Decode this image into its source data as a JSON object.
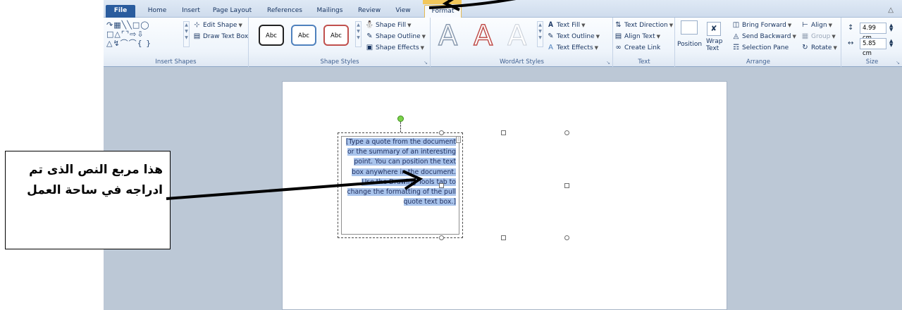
{
  "tabs": [
    "File",
    "Home",
    "Insert",
    "Page Layout",
    "References",
    "Mailings",
    "Review",
    "View",
    "Format"
  ],
  "active_tab": "Format",
  "ribbon": {
    "insert_shapes": {
      "label": "Insert Shapes",
      "edit_shape": "Edit Shape",
      "draw_text_box": "Draw Text Box"
    },
    "shape_styles": {
      "label": "Shape Styles",
      "thumbnails": [
        "Abc",
        "Abc",
        "Abc"
      ],
      "shape_fill": "Shape Fill",
      "shape_outline": "Shape Outline",
      "shape_effects": "Shape Effects"
    },
    "wordart_styles": {
      "label": "WordArt Styles",
      "letters": [
        "A",
        "A",
        "A"
      ],
      "text_fill": "Text Fill",
      "text_outline": "Text Outline",
      "text_effects": "Text Effects"
    },
    "text": {
      "label": "Text",
      "text_direction": "Text Direction",
      "align_text": "Align Text",
      "create_link": "Create Link"
    },
    "arrange": {
      "label": "Arrange",
      "position": "Position",
      "wrap_text_1": "Wrap",
      "wrap_text_2": "Text",
      "bring_forward": "Bring Forward",
      "send_backward": "Send Backward",
      "selection_pane": "Selection Pane",
      "align": "Align",
      "group": "Group",
      "rotate": "Rotate"
    },
    "size": {
      "label": "Size",
      "height": "4.99 cm",
      "width": "5.85 cm"
    }
  },
  "document": {
    "quote_text": "[Type a quote from the document or the summary of an interesting point. You can position the text box anywhere in the document. Use the Drawing Tools tab to change the formatting of the pull quote text box.]"
  },
  "callout": {
    "text": "هذا مربع النص الذى تم ادراجه في ساحة العمل"
  },
  "colors": {
    "file_tab": "#2a5c9e",
    "contextual_tab": "#f2c75b",
    "selection": "#a9c4ec",
    "rotation_handle": "#7bd34a",
    "shape_outline_red": "#c0504d",
    "shape_outline_blue": "#4f81bd"
  }
}
